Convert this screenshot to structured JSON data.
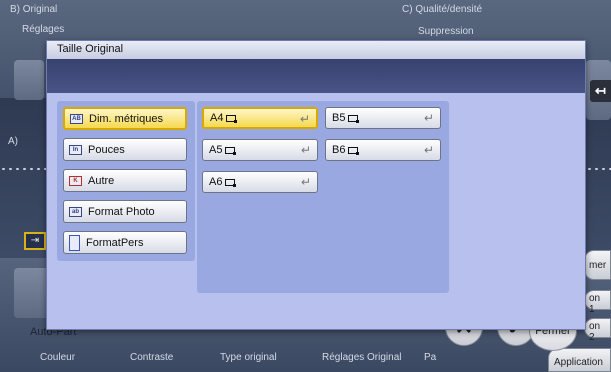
{
  "dialog": {
    "title": "Taille Original",
    "categories": [
      {
        "label": "Dim. métriques",
        "icon": "metric-size-icon",
        "icon_text": "AB",
        "selected": true
      },
      {
        "label": "Pouces",
        "icon": "inch-size-icon",
        "icon_text": "In",
        "selected": false
      },
      {
        "label": "Autre",
        "icon": "other-size-icon",
        "icon_text": "K",
        "selected": false
      },
      {
        "label": "Format Photo",
        "icon": "photo-size-icon",
        "icon_text": "ab",
        "selected": false
      },
      {
        "label": "FormatPers",
        "icon": "custom-size-icon",
        "icon_text": "",
        "selected": false
      }
    ],
    "sizes": [
      {
        "label": "A4",
        "selected": true
      },
      {
        "label": "B5",
        "selected": false
      },
      {
        "label": "A5",
        "selected": false
      },
      {
        "label": "B6",
        "selected": false
      },
      {
        "label": "A6",
        "selected": false
      }
    ]
  },
  "background": {
    "section_b": "B)  Original",
    "section_b_sub": "Réglages",
    "section_c": "C)  Qualité/densité",
    "section_c_sub": "Suppression",
    "section_a": "A)",
    "auto_label": "Auto-Part",
    "bottom_tabs": [
      "Couleur",
      "Contraste",
      "Type original",
      "Réglages Original",
      "Pa"
    ],
    "right_tabs": [
      "mer",
      "on 1",
      "on 2"
    ],
    "application": "Application",
    "fermer": "Fermer"
  },
  "colors": {
    "selected_fill": "#f5d94f",
    "dialog_bg": "#b8c1ee",
    "panel_bg": "#9aa8e2"
  }
}
